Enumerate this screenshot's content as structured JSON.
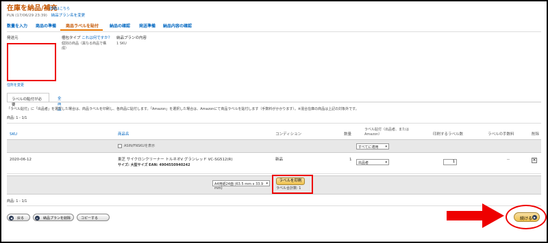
{
  "header": {
    "title": "在庫を納品/補充",
    "title_link": "詳細はこちら",
    "plan_id": "PLN (17/06/29 23:39)",
    "rename_link": "納品プラン名を変更"
  },
  "steps": [
    "数量を入力",
    "商品の準備",
    "商品ラベルを貼付",
    "納品の確認",
    "発送準備",
    "納品内容の確認"
  ],
  "info": {
    "ship_from_label": "発送元",
    "ship_from_change": "住所を変更",
    "packing_label": "梱包タイプ",
    "packing_help": "これは何ですか？",
    "packing_value_1": "個別の商品（異なる商品で構",
    "packing_value_2": "成）",
    "plan_content_label": "納品プランの内容",
    "plan_content_value": "1 SKU"
  },
  "tabs": [
    "ラベルの貼付が必要",
    "全商品"
  ],
  "notice": "「ラベル貼付」に「出品者」を選択した場合は、商品ラベルを印刷し、各商品に貼付します。「Amazon」を選択した場合は、Amazonにて商品ラベルを貼付します（手数料がかかります）。※混合在庫の商品は上記の対象外です。",
  "pagination_top": "商品: 1 - 1/1",
  "pagination_bottom": "商品: 1 - 1/1",
  "table": {
    "headers": {
      "sku": "SKU",
      "product": "商品名",
      "condition": "コンディション",
      "quantity": "数量",
      "label_by": "ラベル貼付（出品者、またはAmazon）",
      "label_by_1": "ラベル貼付（出品者、または",
      "label_by_2": "Amazon）",
      "print_count": "印刷するラベル数",
      "fee": "ラベルの手数料",
      "delete": "削除"
    },
    "asin_toggle": "ASIN/FNSKUを表示",
    "apply_all": "すべてに適用",
    "rows": [
      {
        "sku": "2020-06-12",
        "name": "東芝 サイクロンクリーナー トルネオV グランレッド VC-SG512(R)",
        "details": "サイズ: 大型サイズ EAN: 4904550940242",
        "condition": "新品",
        "quantity": "1",
        "label_by": "出品者",
        "print_count": "1",
        "fee": "--"
      }
    ]
  },
  "print_bar": {
    "paper": "A4用紙24面 (63.5 mm x 33.9 mm)",
    "print_button": "ラベルを印刷",
    "total": "ラベル合計数: 1"
  },
  "footer": {
    "back": "戻る",
    "delete_plan": "納品プランを削除",
    "copy": "コピーする",
    "continue": "続ける"
  }
}
